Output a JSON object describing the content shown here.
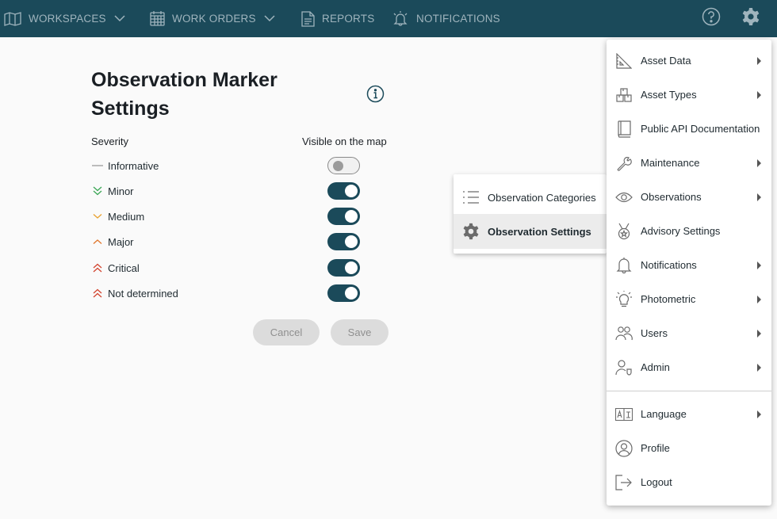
{
  "topbar": {
    "workspaces_label": "WORKSPACES",
    "workorders_label": "WORK ORDERS",
    "reports_label": "REPORTS",
    "notifications_label": "NOTIFICATIONS",
    "help_icon": "help-circle-icon",
    "settings_icon": "gear-icon"
  },
  "panel": {
    "title": "Observation Marker Settings",
    "severity_header": "Severity",
    "visible_header": "Visible on the map",
    "rows": [
      {
        "label": "Informative",
        "icon": "dash-icon",
        "color": "#9a9a9a",
        "visible": false
      },
      {
        "label": "Minor",
        "icon": "double-chevron-down-icon",
        "color": "#3aa655",
        "visible": true
      },
      {
        "label": "Medium",
        "icon": "chevron-down-icon",
        "color": "#e8a12e",
        "visible": true
      },
      {
        "label": "Major",
        "icon": "chevron-up-icon",
        "color": "#e0762b",
        "visible": true
      },
      {
        "label": "Critical",
        "icon": "double-chevron-up-icon",
        "color": "#d2442f",
        "visible": true
      },
      {
        "label": "Not determined",
        "icon": "double-chevron-up-icon",
        "color": "#d2442f",
        "visible": true
      }
    ],
    "cancel_label": "Cancel",
    "save_label": "Save"
  },
  "submenu": {
    "items": [
      {
        "label": "Observation Categories",
        "icon": "list-icon"
      },
      {
        "label": "Observation Settings",
        "icon": "gear-icon"
      }
    ]
  },
  "menu": {
    "items": [
      {
        "label": "Asset Data",
        "icon": "ruler-triangle-icon",
        "has_submenu": true
      },
      {
        "label": "Asset Types",
        "icon": "boxes-icon",
        "has_submenu": true
      },
      {
        "label": "Public API Documentation",
        "icon": "book-icon",
        "has_submenu": false
      },
      {
        "label": "Maintenance",
        "icon": "wrench-icon",
        "has_submenu": true
      },
      {
        "label": "Observations",
        "icon": "eye-icon",
        "has_submenu": true
      },
      {
        "label": "Advisory Settings",
        "icon": "medal-icon",
        "has_submenu": false
      },
      {
        "label": "Notifications",
        "icon": "bell-icon",
        "has_submenu": true
      },
      {
        "label": "Photometric",
        "icon": "bulb-icon",
        "has_submenu": true
      },
      {
        "label": "Users",
        "icon": "users-icon",
        "has_submenu": true
      },
      {
        "label": "Admin",
        "icon": "admin-user-icon",
        "has_submenu": true
      },
      {
        "label": "Language",
        "icon": "language-icon",
        "has_submenu": true
      },
      {
        "label": "Profile",
        "icon": "profile-icon",
        "has_submenu": false
      },
      {
        "label": "Logout",
        "icon": "logout-icon",
        "has_submenu": false
      }
    ]
  },
  "colors": {
    "primary": "#1b4a5a",
    "nav_text": "#9fb4bd"
  }
}
